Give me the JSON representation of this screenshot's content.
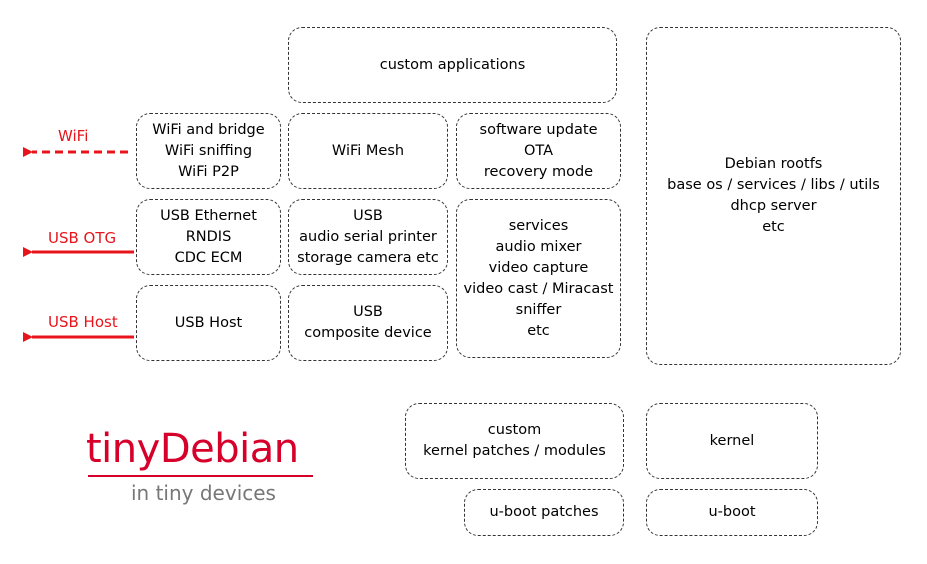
{
  "boxes": {
    "custom_apps": [
      "custom applications"
    ],
    "wifi": [
      "WiFi and bridge",
      "WiFi sniffing",
      "WiFi P2P"
    ],
    "wifi_mesh": [
      "WiFi Mesh"
    ],
    "software_update": [
      "software update",
      "OTA",
      "recovery mode"
    ],
    "usb_ethernet": [
      "USB Ethernet",
      "RNDIS",
      "CDC ECM"
    ],
    "usb_gadgets": [
      "USB",
      "audio serial printer",
      "storage camera etc"
    ],
    "services": [
      "services",
      "audio mixer",
      "video capture",
      "video cast / Miracast",
      "sniffer",
      "etc"
    ],
    "usb_host": [
      "USB Host"
    ],
    "usb_composite": [
      "USB",
      "composite device"
    ],
    "debian_rootfs": [
      "Debian rootfs",
      "base os / services / libs / utils",
      "dhcp server",
      "etc"
    ],
    "kernel_patches": [
      "custom",
      "kernel patches / modules"
    ],
    "kernel": [
      "kernel"
    ],
    "uboot_patches": [
      "u-boot patches"
    ],
    "uboot": [
      "u-boot"
    ]
  },
  "interfaces": {
    "wifi": "WiFi",
    "usb_otg": "USB OTG",
    "usb_host": "USB Host"
  },
  "logo": {
    "title": "tinyDebian",
    "tagline": "in tiny devices"
  },
  "colors": {
    "interface_arrow": "#e8141b",
    "logo": "#d6002a",
    "tagline": "#777777",
    "box_border": "#333333"
  }
}
